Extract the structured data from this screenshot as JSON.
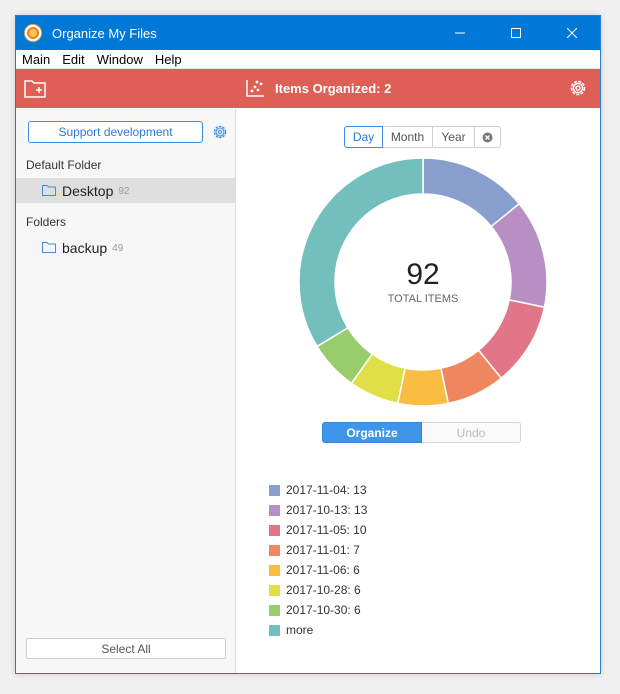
{
  "window": {
    "title": "Organize My Files",
    "controls": {
      "minimize": "—",
      "maximize": "☐",
      "close": "✕"
    }
  },
  "menu": {
    "items": [
      "Main",
      "Edit",
      "Window",
      "Help"
    ]
  },
  "toolbar": {
    "items_organized_label": "Items Organized: 2",
    "left_icon": "add-folder-icon",
    "center_icon": "scatter-chart-icon",
    "right_icon": "gear-icon"
  },
  "sidebar": {
    "support_label": "Support development",
    "default_folder_title": "Default Folder",
    "default_folder": {
      "name": "Desktop",
      "count": "92"
    },
    "folders_title": "Folders",
    "folders": [
      {
        "name": "backup",
        "count": "49"
      }
    ],
    "select_all_label": "Select All"
  },
  "range": {
    "options": [
      "Day",
      "Month",
      "Year"
    ],
    "selected": "Day"
  },
  "summary": {
    "total": "92",
    "total_label": "TOTAL ITEMS"
  },
  "actions": {
    "organize_label": "Organize",
    "undo_label": "Undo"
  },
  "chart_data": {
    "type": "pie",
    "donut": true,
    "categories": [
      "2017-11-04",
      "2017-10-13",
      "2017-11-05",
      "2017-11-01",
      "2017-11-06",
      "2017-10-28",
      "2017-10-30",
      "more"
    ],
    "values": [
      13,
      13,
      10,
      7,
      6,
      6,
      6,
      31
    ],
    "colors": [
      "#889fce",
      "#b78fc3",
      "#e27689",
      "#ee8660",
      "#f9bd42",
      "#e1df47",
      "#99cc6a",
      "#73bfbd"
    ],
    "legend_labels": [
      "2017-11-04: 13",
      "2017-10-13: 13",
      "2017-11-05: 10",
      "2017-11-01: 7",
      "2017-11-06: 6",
      "2017-10-28: 6",
      "2017-10-30: 6",
      "more"
    ],
    "legend_placement": "bottom-left"
  }
}
